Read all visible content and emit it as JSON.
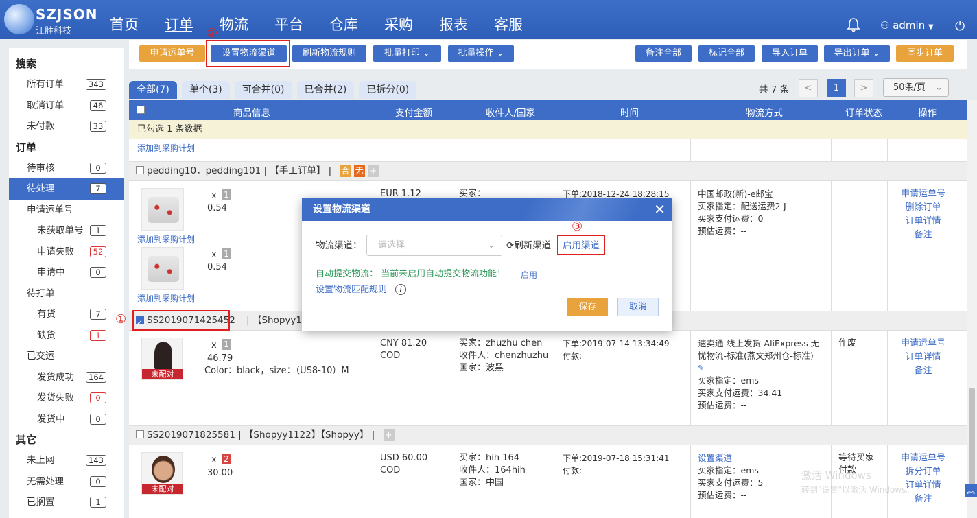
{
  "app": {
    "brand": "SZJSON",
    "brand_sub": "江胜科技",
    "user": "admin"
  },
  "nav": [
    "首页",
    "订单",
    "物流",
    "平台",
    "仓库",
    "采购",
    "报表",
    "客服"
  ],
  "colors": {
    "primary": "#3d6dc7",
    "accent": "#e8a33d",
    "danger": "#c8262e",
    "highlight": "#e02020"
  },
  "sidebar": [
    {
      "type": "group",
      "label": "搜索"
    },
    {
      "type": "item",
      "label": "所有订单",
      "badge": "343"
    },
    {
      "type": "item",
      "label": "取消订单",
      "badge": "46"
    },
    {
      "type": "item",
      "label": "未付款",
      "badge": "33"
    },
    {
      "type": "group",
      "label": "订单"
    },
    {
      "type": "item",
      "label": "待审核",
      "badge": "0"
    },
    {
      "type": "item",
      "label": "待处理",
      "badge": "7",
      "active": true
    },
    {
      "type": "item",
      "label": "申请运单号"
    },
    {
      "type": "sub",
      "label": "未获取单号",
      "badge": "1"
    },
    {
      "type": "sub",
      "label": "申请失败",
      "badge": "52",
      "red": true
    },
    {
      "type": "sub",
      "label": "申请中",
      "badge": "0"
    },
    {
      "type": "item",
      "label": "待打单"
    },
    {
      "type": "sub",
      "label": "有货",
      "badge": "7"
    },
    {
      "type": "sub",
      "label": "缺货",
      "badge": "1",
      "red": true
    },
    {
      "type": "item",
      "label": "已交运"
    },
    {
      "type": "sub",
      "label": "发货成功",
      "badge": "164"
    },
    {
      "type": "sub",
      "label": "发货失败",
      "badge": "0",
      "red": true
    },
    {
      "type": "sub",
      "label": "发货中",
      "badge": "0"
    },
    {
      "type": "group",
      "label": "其它"
    },
    {
      "type": "item",
      "label": "未上网",
      "badge": "143"
    },
    {
      "type": "item",
      "label": "无需处理",
      "badge": "0"
    },
    {
      "type": "item",
      "label": "已搁置",
      "badge": "1"
    }
  ],
  "toolbar": {
    "apply_waybill": "申请运单号",
    "set_channel": "设置物流渠道",
    "refresh_rules": "刷新物流规则",
    "batch_print": "批量打印",
    "batch_ops": "批量操作",
    "remark_all": "备注全部",
    "mark_all": "标记全部",
    "import_orders": "导入订单",
    "export_orders": "导出订单",
    "sync_orders": "同步订单"
  },
  "markers": {
    "m1": "①",
    "m2": "②",
    "m3": "③"
  },
  "tabs": [
    "全部(7)",
    "单个(3)",
    "可合并(0)",
    "已合并(2)",
    "已拆分(0)"
  ],
  "pager": {
    "total": "共 7 条",
    "prev": "<",
    "page": "1",
    "next": ">",
    "size": "50条/页"
  },
  "table": {
    "headers": {
      "product": "商品信息",
      "amount": "支付金额",
      "receiver": "收件人/国家",
      "time": "时间",
      "logistics": "物流方式",
      "status": "订单状态",
      "ops": "操作"
    },
    "selected_info": "已勾选 1 条数据",
    "add_to_plan": "添加到采购计划"
  },
  "order1": {
    "header": "pedding10，pedding101  |  【手工订单】  |",
    "tag1": "合",
    "tag2": "无",
    "tag3": "+",
    "item1_qty": "1",
    "item1_price": "0.54",
    "item2_qty": "1",
    "item2_price": "0.54",
    "amount": "EUR  1.12",
    "buyer_label": "买家：",
    "order_time": "下单:2018-12-24 18:28:15",
    "logistics": [
      "中国邮政(新)-e邮宝",
      "买家指定：配送运费2-J",
      "买家支付运费：0",
      "预估运费：--"
    ],
    "ops": [
      "申请运单号",
      "删除订单",
      "订单详情",
      "备注"
    ]
  },
  "order2": {
    "id": "SS2019071425452",
    "header_rest": "|  【Shopyy1122",
    "qty": "1",
    "price": "46.79",
    "variant": "Color：black，size：（US8-10）M",
    "unmatched": "未配对",
    "amount": "CNY  81.20",
    "pay": "COD",
    "buyer": "买家：zhuzhu chen",
    "receiver": "收件人：chenzhuzhu",
    "country": "国家：波黑",
    "order_time": "下单:2019-07-14 13:34:49",
    "pay_time": "付款:",
    "logistics": [
      "速卖通-线上发货-AliExpress 无",
      "忧物流-标准(燕文郑州仓-标准)",
      "买家指定：ems",
      "买家支付运费：34.41",
      "预估运费：--"
    ],
    "status": "作废",
    "ops": [
      "申请运单号",
      "订单详情",
      "备注"
    ]
  },
  "order3": {
    "header": "SS2019071825581  |  【Shopyy1122】【Shopyy】  |",
    "plus": "+",
    "qty": "2",
    "price": "30.00",
    "unmatched": "未配对",
    "amount": "USD  60.00",
    "pay": "COD",
    "buyer": "买家：hih 164",
    "receiver": "收件人：164hih",
    "country": "国家：中国",
    "order_time": "下单:2019-07-18 15:31:41",
    "pay_time": "付款:",
    "logistics_link": "设置渠道",
    "logistics": [
      "买家指定：ems",
      "买家支付运费：5",
      "预估运费：--"
    ],
    "status": [
      "等待买家",
      "付款"
    ],
    "ops": [
      "申请运单号",
      "拆分订单",
      "订单详情",
      "备注"
    ]
  },
  "modal": {
    "title": "设置物流渠道",
    "close": "✕",
    "channel_label": "物流渠道：",
    "placeholder": "请选择",
    "refresh": "刷新渠道",
    "enable": "启用渠道",
    "auto_submit": "自动提交物流：  当前未启用自动提交物流功能！",
    "auto_enable": "启用",
    "match_rules": "设置物流匹配规则",
    "save": "保存",
    "cancel": "取消"
  },
  "watermark": [
    "激活 Windows",
    "转到\"设置\"以激活 Windows。"
  ]
}
